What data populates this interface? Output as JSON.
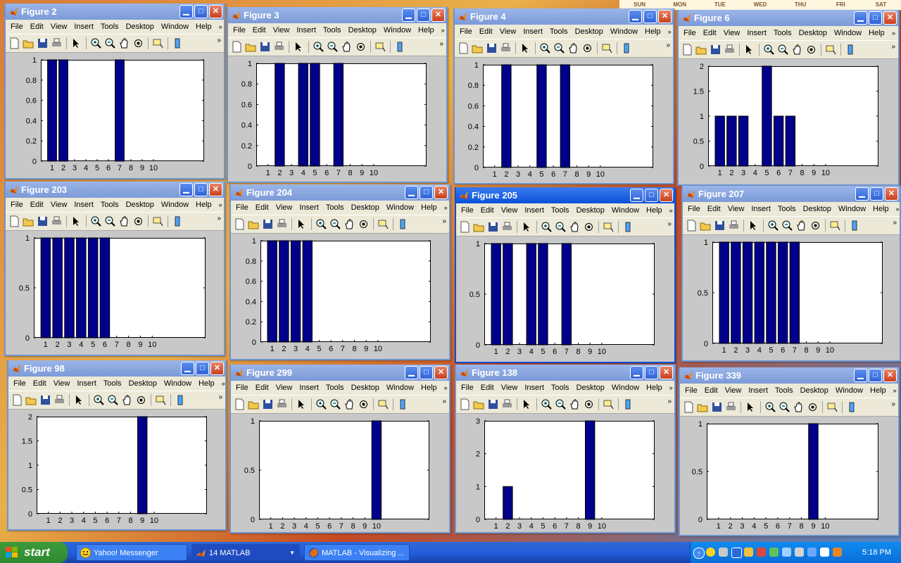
{
  "calendar": {
    "days": [
      "SUN",
      "MON",
      "TUE",
      "WED",
      "THU",
      "FRI",
      "SAT"
    ]
  },
  "menu": [
    "File",
    "Edit",
    "View",
    "Insert",
    "Tools",
    "Desktop",
    "Window",
    "Help"
  ],
  "figures": [
    {
      "title": "Figure 2",
      "xticks": [
        "1",
        "2",
        "3",
        "4",
        "5",
        "6",
        "7",
        "8",
        "9",
        "10"
      ],
      "yticks": [
        "0",
        "0.2",
        "0.4",
        "0.6",
        "0.8",
        "1"
      ],
      "chart_data": {
        "type": "bar",
        "x": [
          1,
          2,
          7
        ],
        "values": [
          1,
          1,
          1
        ],
        "ylim": [
          0,
          1
        ],
        "xlim": [
          0,
          14.5
        ]
      }
    },
    {
      "title": "Figure 3",
      "xticks": [
        "1",
        "2",
        "3",
        "4",
        "5",
        "6",
        "7",
        "8",
        "9",
        "10"
      ],
      "yticks": [
        "0",
        "0.2",
        "0.4",
        "0.6",
        "0.8",
        "1"
      ],
      "chart_data": {
        "type": "bar",
        "x": [
          2,
          4,
          5,
          7
        ],
        "values": [
          1,
          1,
          1,
          1
        ],
        "ylim": [
          0,
          1
        ],
        "xlim": [
          0,
          14.5
        ]
      }
    },
    {
      "title": "Figure 4",
      "xticks": [
        "1",
        "2",
        "3",
        "4",
        "5",
        "6",
        "7",
        "8",
        "9",
        "10"
      ],
      "yticks": [
        "0",
        "0.2",
        "0.4",
        "0.6",
        "0.8",
        "1"
      ],
      "chart_data": {
        "type": "bar",
        "x": [
          2,
          5,
          7
        ],
        "values": [
          1,
          1,
          1
        ],
        "ylim": [
          0,
          1
        ],
        "xlim": [
          0,
          14.5
        ]
      }
    },
    {
      "title": "Figure 6",
      "xticks": [
        "1",
        "2",
        "3",
        "4",
        "5",
        "6",
        "7",
        "8",
        "9",
        "10"
      ],
      "yticks": [
        "0",
        "0.5",
        "1",
        "1.5",
        "2"
      ],
      "chart_data": {
        "type": "bar",
        "x": [
          1,
          2,
          3,
          5,
          6,
          7
        ],
        "values": [
          1,
          1,
          1,
          2,
          1,
          1
        ],
        "ylim": [
          0,
          2
        ],
        "xlim": [
          0,
          14.5
        ]
      }
    },
    {
      "title": "Figure 203",
      "xticks": [
        "1",
        "2",
        "3",
        "4",
        "5",
        "6",
        "7",
        "8",
        "9",
        "10"
      ],
      "yticks": [
        "0",
        "0.5",
        "1"
      ],
      "chart_data": {
        "type": "bar",
        "x": [
          1,
          2,
          3,
          4,
          5,
          6
        ],
        "values": [
          1,
          1,
          1,
          1,
          1,
          1
        ],
        "ylim": [
          0,
          1
        ],
        "xlim": [
          0,
          14.5
        ]
      }
    },
    {
      "title": "Figure 204",
      "xticks": [
        "1",
        "2",
        "3",
        "4",
        "5",
        "6",
        "7",
        "8",
        "9",
        "10"
      ],
      "yticks": [
        "0",
        "0.2",
        "0.4",
        "0.6",
        "0.8",
        "1"
      ],
      "chart_data": {
        "type": "bar",
        "x": [
          1,
          2,
          3,
          4
        ],
        "values": [
          1,
          1,
          1,
          1
        ],
        "ylim": [
          0,
          1
        ],
        "xlim": [
          0,
          14.5
        ]
      }
    },
    {
      "title": "Figure 205",
      "xticks": [
        "1",
        "2",
        "3",
        "4",
        "5",
        "6",
        "7",
        "8",
        "9",
        "10"
      ],
      "yticks": [
        "0",
        "0.5",
        "1"
      ],
      "chart_data": {
        "type": "bar",
        "x": [
          1,
          2,
          4,
          5,
          7
        ],
        "values": [
          1,
          1,
          1,
          1,
          1
        ],
        "ylim": [
          0,
          1
        ],
        "xlim": [
          0,
          14.5
        ]
      }
    },
    {
      "title": "Figure 207",
      "xticks": [
        "1",
        "2",
        "3",
        "4",
        "5",
        "6",
        "7",
        "8",
        "9",
        "10"
      ],
      "yticks": [
        "0",
        "0.5",
        "1"
      ],
      "chart_data": {
        "type": "bar",
        "x": [
          1,
          2,
          3,
          4,
          5,
          6,
          7
        ],
        "values": [
          1,
          1,
          1,
          1,
          1,
          1,
          1
        ],
        "ylim": [
          0,
          1
        ],
        "xlim": [
          0,
          14.5
        ]
      }
    },
    {
      "title": "Figure 98",
      "xticks": [
        "1",
        "2",
        "3",
        "4",
        "5",
        "6",
        "7",
        "8",
        "9",
        "10"
      ],
      "yticks": [
        "0",
        "0.5",
        "1",
        "1.5",
        "2"
      ],
      "chart_data": {
        "type": "bar",
        "x": [
          9
        ],
        "values": [
          2
        ],
        "ylim": [
          0,
          2
        ],
        "xlim": [
          0,
          14.5
        ]
      }
    },
    {
      "title": "Figure 299",
      "xticks": [
        "1",
        "2",
        "3",
        "4",
        "5",
        "6",
        "7",
        "8",
        "9",
        "10"
      ],
      "yticks": [
        "0",
        "0.5",
        "1"
      ],
      "chart_data": {
        "type": "bar",
        "x": [
          10
        ],
        "values": [
          1
        ],
        "ylim": [
          0,
          1
        ],
        "xlim": [
          0,
          14.5
        ]
      }
    },
    {
      "title": "Figure 138",
      "xticks": [
        "1",
        "2",
        "3",
        "4",
        "5",
        "6",
        "7",
        "8",
        "9",
        "10"
      ],
      "yticks": [
        "0",
        "1",
        "2",
        "3"
      ],
      "chart_data": {
        "type": "bar",
        "x": [
          2,
          9
        ],
        "values": [
          1,
          3
        ],
        "ylim": [
          0,
          3
        ],
        "xlim": [
          0,
          14.5
        ]
      }
    },
    {
      "title": "Figure 339",
      "xticks": [
        "1",
        "2",
        "3",
        "4",
        "5",
        "6",
        "7",
        "8",
        "9",
        "10"
      ],
      "yticks": [
        "0",
        "0.5",
        "1"
      ],
      "chart_data": {
        "type": "bar",
        "x": [
          9
        ],
        "values": [
          1
        ],
        "ylim": [
          0,
          1
        ],
        "xlim": [
          0,
          14.5
        ]
      }
    }
  ],
  "taskbar": {
    "start_label": "start",
    "tasks": [
      "Yahoo! Messenger",
      "14 MATLAB",
      "MATLAB - Visualizing ..."
    ],
    "clock": "5:18 PM"
  },
  "colors": {
    "bar": "#00008b",
    "bar_edge": "#000000",
    "titlebar_active": "#0a52d9",
    "titlebar_inactive": "#7c9ad8"
  }
}
